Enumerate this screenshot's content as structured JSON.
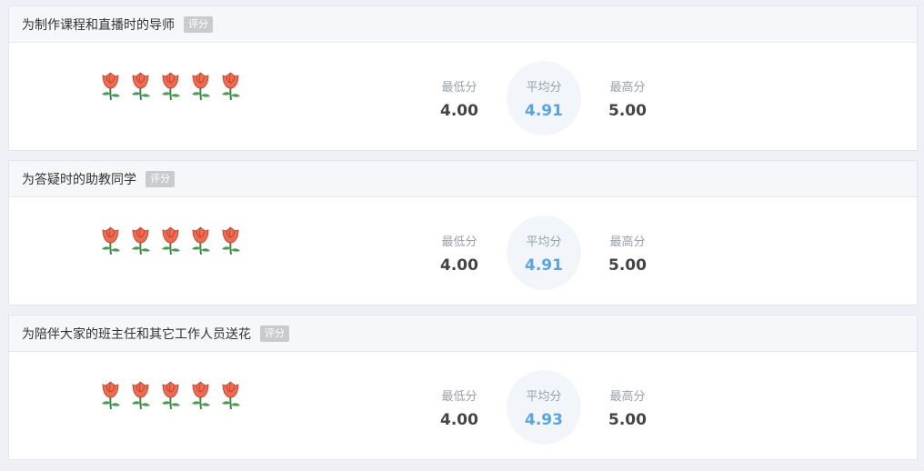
{
  "cards": [
    {
      "title": "为制作课程和直播时的导师",
      "badge": "评分",
      "rating_flowers": 5,
      "min_label": "最低分",
      "min_value": "4.00",
      "avg_label": "平均分",
      "avg_value": "4.91",
      "max_label": "最高分",
      "max_value": "5.00"
    },
    {
      "title": "为答疑时的助教同学",
      "badge": "评分",
      "rating_flowers": 5,
      "min_label": "最低分",
      "min_value": "4.00",
      "avg_label": "平均分",
      "avg_value": "4.91",
      "max_label": "最高分",
      "max_value": "5.00"
    },
    {
      "title": "为陪伴大家的班主任和其它工作人员送花",
      "badge": "评分",
      "rating_flowers": 5,
      "min_label": "最低分",
      "min_value": "4.00",
      "avg_label": "平均分",
      "avg_value": "4.93",
      "max_label": "最高分",
      "max_value": "5.00"
    }
  ],
  "icons": {
    "flower": "rose-icon"
  },
  "colors": {
    "avg_value": "#5aa5e0",
    "badge_bg": "#c9cbcf",
    "page_bg": "#eef0f6"
  }
}
